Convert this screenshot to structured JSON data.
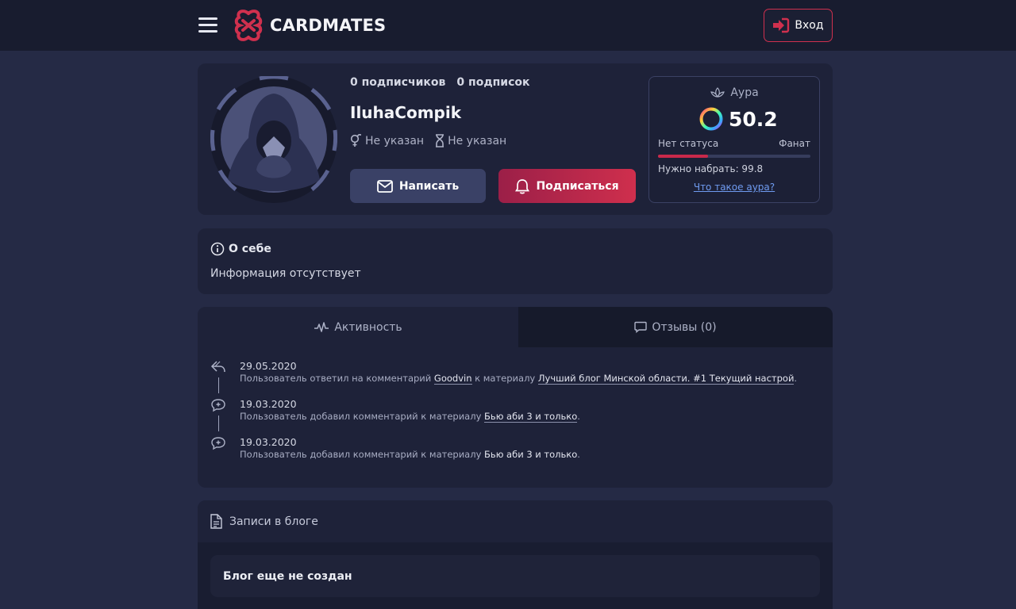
{
  "header": {
    "brand": "CARDMATES",
    "login_label": "Вход",
    "colors": {
      "accent": "#d0304e",
      "bar": "#181c2f"
    }
  },
  "profile": {
    "followers": "0 подписчиков",
    "following": "0 подписок",
    "username": "IluhaCompik",
    "gender": "Не указан",
    "age": "Не указан",
    "write_label": "Написать",
    "subscribe_label": "Подписаться"
  },
  "aura": {
    "title": "Аура",
    "value": "50.2",
    "status_left": "Нет статуса",
    "status_right": "Фанат",
    "progress_fraction": 0.33,
    "need_text": "Нужно набрать: 99.8",
    "link_text": "Что такое аура?"
  },
  "about": {
    "title": "О себе",
    "text": "Информация отсутствует"
  },
  "tabs": {
    "activity_label": "Активность",
    "reviews_label": "Отзывы (0)"
  },
  "activity": [
    {
      "date": "29.05.2020",
      "prefix": "Пользователь ответил на комментарий ",
      "user": "Goodvin",
      "mid": " к материалу ",
      "material": "Лучший блог Минской области. #1 Текущий настрой",
      "suffix": ".",
      "icon": "reply-icon"
    },
    {
      "date": "19.03.2020",
      "prefix": "Пользователь добавил комментарий к материалу ",
      "material": "Бью аби 3 и только",
      "suffix": ".",
      "icon": "comment-add-icon"
    },
    {
      "date": "19.03.2020",
      "prefix": "Пользователь добавил комментарий к материалу ",
      "material": "Бью аби 3 и только",
      "suffix": ".",
      "icon": "comment-add-icon"
    }
  ],
  "blog": {
    "title": "Записи в блоге",
    "empty_text": "Блог еще не создан"
  }
}
